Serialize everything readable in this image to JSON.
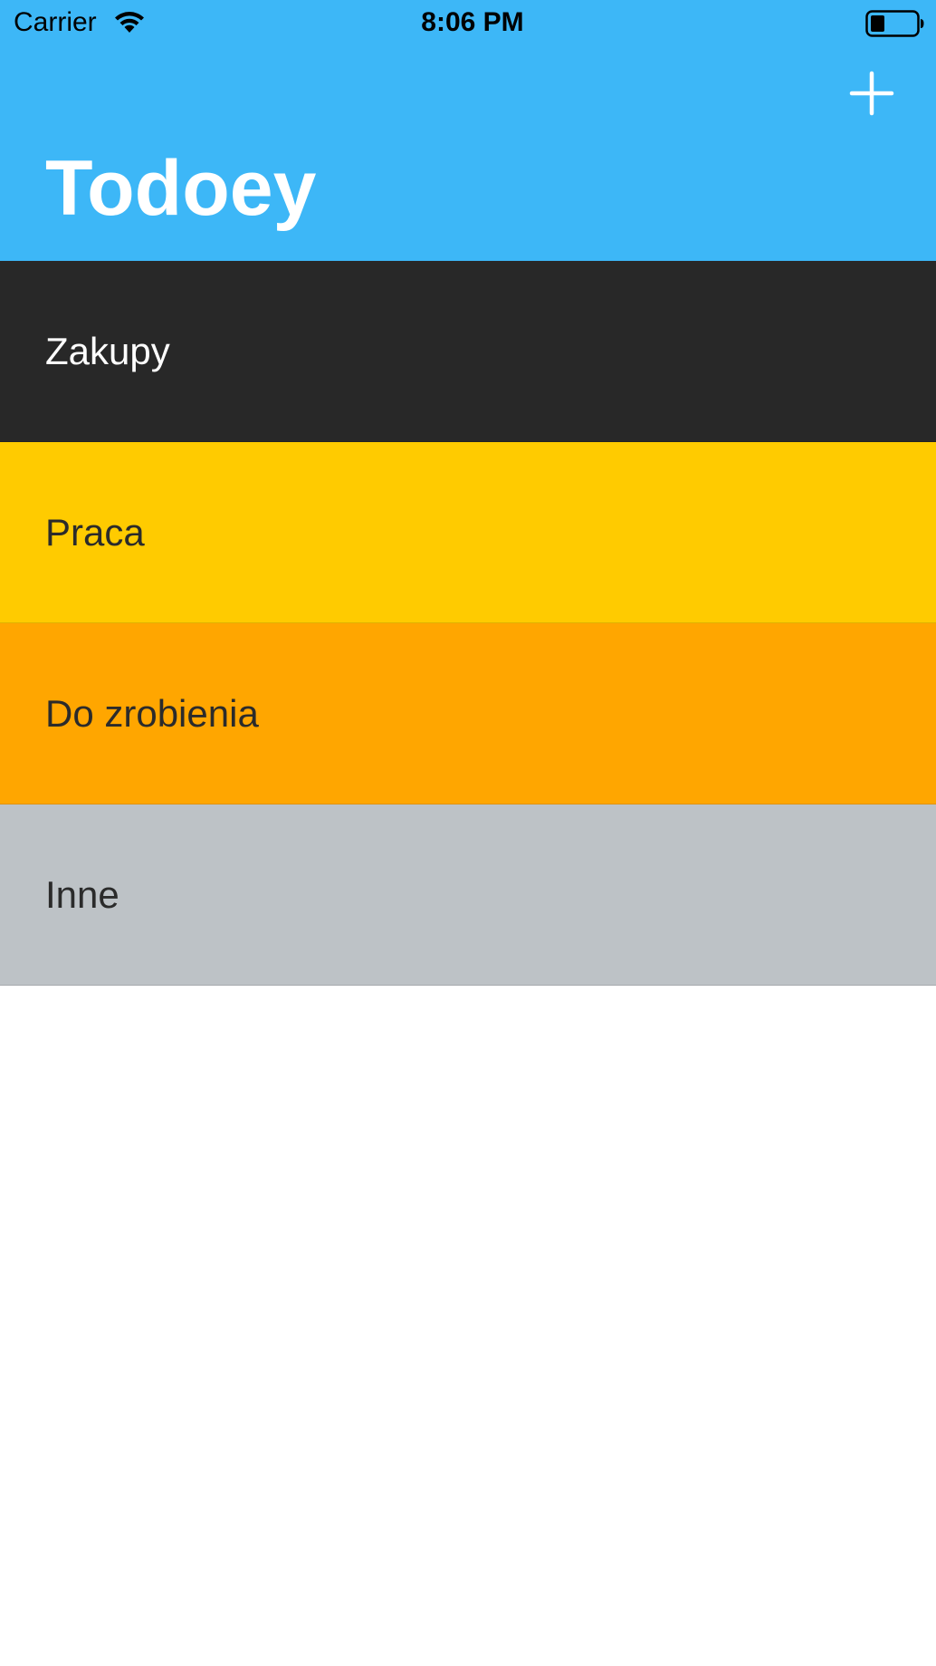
{
  "status_bar": {
    "carrier": "Carrier",
    "time": "8:06 PM",
    "wifi_icon": "wifi-icon",
    "battery_icon": "battery-icon"
  },
  "nav": {
    "title": "Todoey",
    "add_icon": "plus-icon",
    "background_color": "#3db7f7"
  },
  "categories": [
    {
      "label": "Zakupy",
      "color": "#282828",
      "text_color": "#ffffff"
    },
    {
      "label": "Praca",
      "color": "#ffcb00",
      "text_color": "#2b2b2b"
    },
    {
      "label": "Do zrobienia",
      "color": "#ffa600",
      "text_color": "#2b2b2b"
    },
    {
      "label": "Inne",
      "color": "#bdc2c6",
      "text_color": "#2b2b2b"
    }
  ]
}
